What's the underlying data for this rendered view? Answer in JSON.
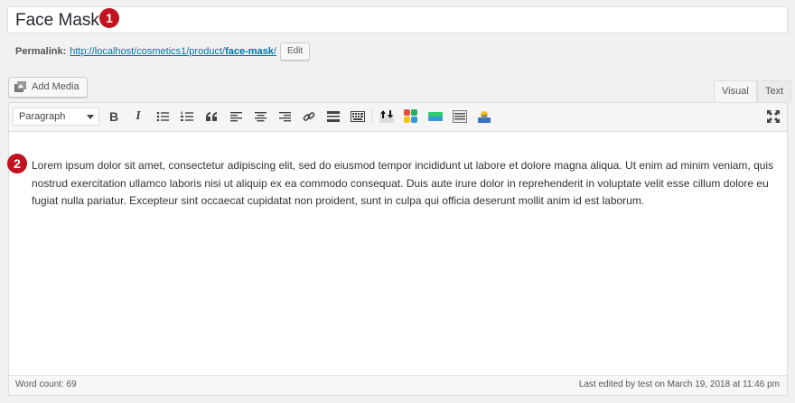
{
  "title": {
    "value": "Face Mask",
    "badge": "1"
  },
  "permalink": {
    "label": "Permalink:",
    "base": "http://localhost/cosmetics1/product/",
    "slug": "face-mask",
    "trail": "/",
    "edit_label": "Edit"
  },
  "media": {
    "add_label": "Add Media"
  },
  "tabs": {
    "visual": "Visual",
    "text": "Text"
  },
  "toolbar": {
    "format": "Paragraph",
    "buttons": [
      "bold-icon",
      "italic-icon",
      "bullet-list-icon",
      "numbered-list-icon",
      "blockquote-icon",
      "align-left-icon",
      "align-center-icon",
      "align-right-icon",
      "link-icon",
      "read-more-icon",
      "toolbar-toggle-icon",
      "plugin-icon-1",
      "plugin-icon-2",
      "plugin-icon-3",
      "plugin-icon-4",
      "plugin-icon-5",
      "fullscreen-icon"
    ]
  },
  "content": {
    "badge": "2",
    "text": "Lorem ipsum dolor sit amet, consectetur adipiscing elit, sed do eiusmod tempor incididunt ut labore et dolore magna aliqua. Ut enim ad minim veniam, quis nostrud exercitation ullamco laboris nisi ut aliquip ex ea commodo consequat. Duis aute irure dolor in reprehenderit in voluptate velit esse cillum dolore eu fugiat nulla pariatur. Excepteur sint occaecat cupidatat non proident, sunt in culpa qui officia deserunt mollit anim id est laborum."
  },
  "status": {
    "word_count": "Word count: 69",
    "last_edited": "Last edited by test on March 19, 2018 at 11:46 pm"
  },
  "colors": {
    "badge": "#c1121f",
    "link": "#0073aa"
  }
}
